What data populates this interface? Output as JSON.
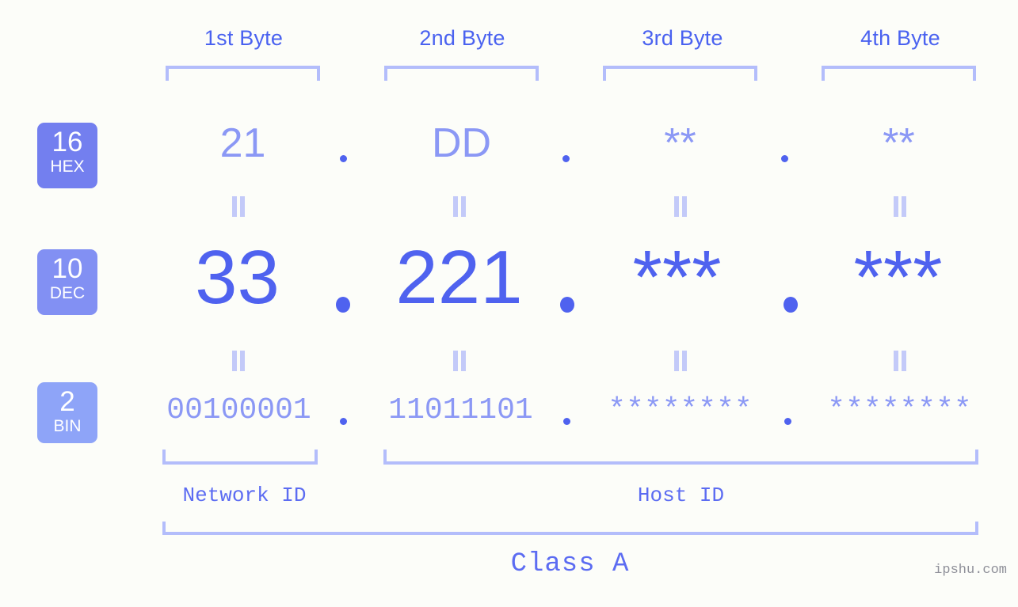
{
  "background_color": "#fcfdf9",
  "accent_colors": {
    "deep_blue": "#4f62ef",
    "mid_blue": "#8b98f5",
    "light_blue": "#b3bdfb",
    "pale_blue": "#c3caf9",
    "watermark_gray": "#8f9099"
  },
  "byte_headers": [
    {
      "label": "1st Byte"
    },
    {
      "label": "2nd Byte"
    },
    {
      "label": "3rd Byte"
    },
    {
      "label": "4th Byte"
    }
  ],
  "rows": [
    {
      "id": "hex",
      "badge_base": "16",
      "badge_name": "HEX",
      "badge_color": "#737fef",
      "values": [
        "21",
        "DD",
        "**",
        "**"
      ],
      "separators": [
        ".",
        ".",
        "."
      ]
    },
    {
      "id": "dec",
      "badge_base": "10",
      "badge_name": "DEC",
      "badge_color": "#8290f3",
      "values": [
        "33",
        "221",
        "***",
        "***"
      ],
      "separators": [
        ".",
        ".",
        "."
      ]
    },
    {
      "id": "bin",
      "badge_base": "2",
      "badge_name": "BIN",
      "badge_color": "#8ea4f8",
      "values": [
        "00100001",
        "11011101",
        "********",
        "********"
      ],
      "separators": [
        ".",
        ".",
        "."
      ]
    }
  ],
  "equivalence_symbol": "=",
  "id_sections": [
    {
      "label": "Network ID"
    },
    {
      "label": "Host ID"
    }
  ],
  "class_label": "Class A",
  "watermark": "ipshu.com"
}
